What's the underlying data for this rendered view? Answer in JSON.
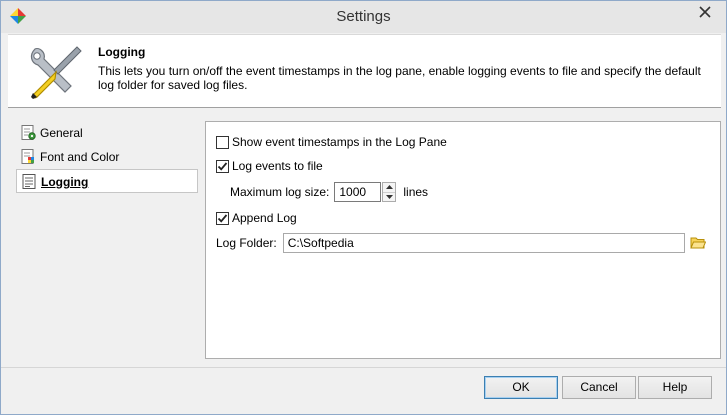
{
  "window": {
    "title": "Settings"
  },
  "header": {
    "title": "Logging",
    "description": "This lets you turn on/off the event timestamps in the log pane, enable logging events to file and specify the default log folder for saved log files."
  },
  "sidebar": {
    "items": [
      {
        "label": "General",
        "icon": "gear-page-icon",
        "selected": false
      },
      {
        "label": "Font and Color",
        "icon": "palette-page-icon",
        "selected": false
      },
      {
        "label": "Logging",
        "icon": "log-page-icon",
        "selected": true
      }
    ]
  },
  "logging": {
    "show_timestamps": {
      "label": "Show event timestamps in the Log Pane",
      "checked": false
    },
    "log_to_file": {
      "label": "Log events to file",
      "checked": true
    },
    "max_log_size": {
      "label": "Maximum log size:",
      "value": "1000",
      "unit": "lines"
    },
    "append_log": {
      "label": "Append Log",
      "checked": true
    },
    "log_folder": {
      "label": "Log Folder:",
      "value": "C:\\Softpedia"
    }
  },
  "buttons": {
    "ok": "OK",
    "cancel": "Cancel",
    "help": "Help"
  },
  "colors": {
    "accent": "#3c7fb1",
    "titlebar": "#e6e6e6"
  }
}
